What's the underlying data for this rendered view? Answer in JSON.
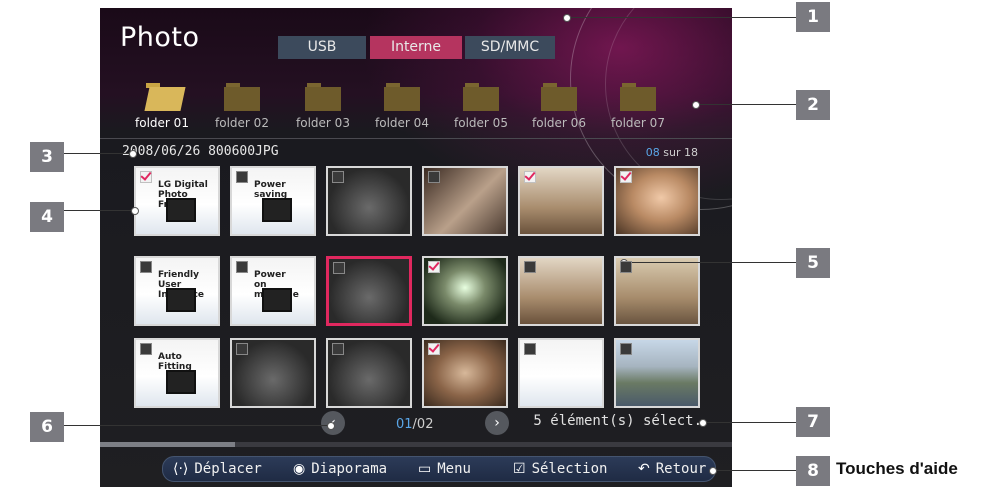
{
  "screen": {
    "title": "Photo",
    "sources": [
      {
        "label": "USB",
        "active": false
      },
      {
        "label": "Interne",
        "active": true
      },
      {
        "label": "SD/MMC",
        "active": false
      }
    ],
    "folders": [
      "folder 01",
      "folder 02",
      "folder 03",
      "folder 04",
      "folder 05",
      "folder 06",
      "folder 07"
    ],
    "open_folder_index": 0,
    "file_info": "2008/06/26 800600JPG",
    "counter": {
      "current": "08",
      "sep": " sur ",
      "total": "18"
    },
    "thumbnails": {
      "rows": [
        [
          {
            "checked": true,
            "texts": [
              "LG Digital",
              "Photo Frame"
            ],
            "theme": "white"
          },
          {
            "checked": false,
            "texts": [
              "Power",
              "saving"
            ],
            "theme": "white"
          },
          {
            "checked": false,
            "texts": [],
            "theme": "dark"
          },
          {
            "checked": false,
            "texts": [],
            "theme": "brown"
          },
          {
            "checked": true,
            "texts": [],
            "theme": "room"
          },
          {
            "checked": true,
            "texts": [],
            "theme": "portrait"
          }
        ],
        [
          {
            "checked": false,
            "texts": [
              "Friendly",
              "User Interface"
            ],
            "theme": "white"
          },
          {
            "checked": false,
            "texts": [
              "Power",
              "on message"
            ],
            "theme": "white"
          },
          {
            "checked": false,
            "texts": [],
            "theme": "dark",
            "focused": true
          },
          {
            "checked": true,
            "texts": [],
            "theme": "tunnel"
          },
          {
            "checked": false,
            "texts": [],
            "theme": "room"
          },
          {
            "checked": false,
            "texts": [],
            "theme": "cream"
          }
        ],
        [
          {
            "checked": false,
            "texts": [
              "Auto",
              "Fitting"
            ],
            "theme": "white"
          },
          {
            "checked": false,
            "texts": [],
            "theme": "dark"
          },
          {
            "checked": false,
            "texts": [],
            "theme": "dark"
          },
          {
            "checked": true,
            "texts": [],
            "theme": "couple"
          },
          {
            "checked": false,
            "texts": [],
            "theme": "white"
          },
          {
            "checked": false,
            "texts": [],
            "theme": "castle"
          }
        ]
      ]
    },
    "pager": {
      "current": "01",
      "total": "/02"
    },
    "selection_count": "5 élément(s) sélect.",
    "help": [
      {
        "icon": "move-icon",
        "glyph": "⟨·⟩",
        "label": "Déplacer"
      },
      {
        "icon": "slideshow-icon",
        "glyph": "◉",
        "label": "Diaporama"
      },
      {
        "icon": "menu-icon",
        "glyph": "▭",
        "label": "Menu"
      },
      {
        "icon": "select-icon",
        "glyph": "☑",
        "label": "Sélection"
      },
      {
        "icon": "return-icon",
        "glyph": "↶",
        "label": "Retour"
      }
    ]
  },
  "callouts": [
    "1",
    "2",
    "3",
    "4",
    "5",
    "6",
    "7",
    "8"
  ],
  "help_caption": "Touches d'aide",
  "colors": {
    "accent": "#b5345f",
    "highlight": "#5aa6e8",
    "callout": "#7a7a80"
  }
}
